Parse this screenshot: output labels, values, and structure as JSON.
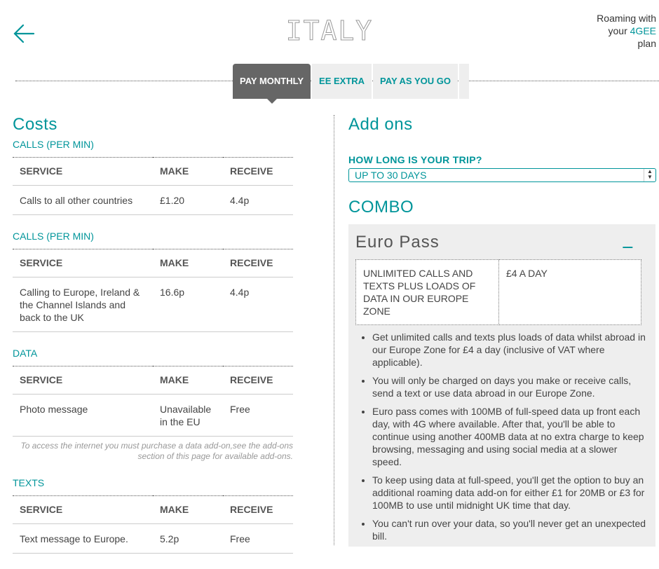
{
  "header": {
    "title": "ITALY",
    "roaming": {
      "line1": "Roaming with",
      "line2_prefix": "your ",
      "brand": "4GEE",
      "line3": "plan"
    }
  },
  "tabs": [
    "PAY MONTHLY",
    "EE EXTRA",
    "PAY AS YOU GO"
  ],
  "costs": {
    "heading": "Costs",
    "columns": [
      "SERVICE",
      "MAKE",
      "RECEIVE"
    ],
    "sections": [
      {
        "title": "CALLS (PER MIN)",
        "rows": [
          [
            "Calls to all other countries",
            "£1.20",
            "4.4p"
          ]
        ]
      },
      {
        "title": "CALLS (PER MIN)",
        "rows": [
          [
            "Calling to Europe, Ireland & the Channel Islands and back to the UK",
            "16.6p",
            "4.4p"
          ]
        ]
      },
      {
        "title": "DATA",
        "rows": [
          [
            "Photo message",
            "Unavailable in the EU",
            "Free"
          ]
        ],
        "note": "To access the internet you must purchase a data add-on,see the add-ons section of this page for available add-ons."
      },
      {
        "title": "TEXTS",
        "rows": [
          [
            "Text message to Europe.",
            "5.2p",
            "Free"
          ]
        ]
      }
    ]
  },
  "addons": {
    "heading": "Add ons",
    "trip_label": "HOW LONG IS YOUR TRIP?",
    "trip_selected": "UP TO 30 DAYS",
    "combo_heading": "COMBO",
    "card": {
      "title": "Euro Pass",
      "toggle": "----",
      "desc": "UNLIMITED CALLS AND TEXTS PLUS LOADS OF DATA IN OUR EUROPE ZONE",
      "price": "£4 A DAY",
      "points": [
        "Get unlimited calls and texts plus loads of data whilst abroad in our Europe Zone for £4 a day (inclusive of VAT where applicable).",
        "You will only be charged on days you make or receive calls, send a text or use data abroad in our Europe Zone.",
        "Euro pass comes with 100MB of full-speed data up front each day, with 4G where available. After that, you'll be able to continue using another 400MB data at no extra charge to keep browsing, messaging and using social media at a slower speed.",
        "To keep using data at full-speed, you'll get the option to buy an additional roaming data add-on for either £1 for 20MB or £3 for 100MB to use until midnight UK time that day.",
        "You can't run over your data, so you'll never get an unexpected bill."
      ]
    }
  },
  "icons": {
    "back": "back-arrow-icon",
    "select": "select-arrows-icon"
  },
  "colors": {
    "accent": "#00959a",
    "tab_active": "#666666",
    "card_bg": "#eeeeee"
  }
}
